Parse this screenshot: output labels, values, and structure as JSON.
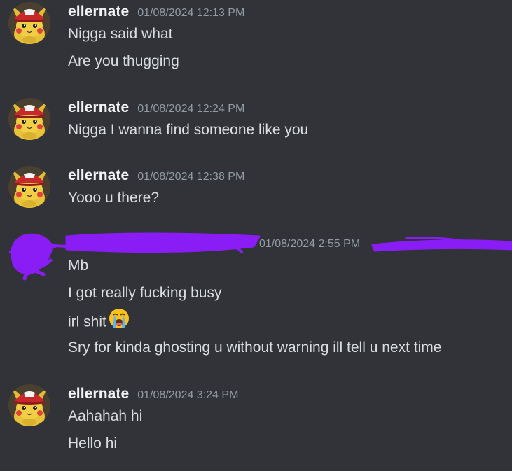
{
  "colors": {
    "background": "#313338",
    "username": "#f2f3f5",
    "timestamp": "#949ba4",
    "message_text": "#dbdee1",
    "redaction": "#8a1cf5"
  },
  "messages": [
    {
      "author": "ellernate",
      "timestamp": "01/08/2024 12:13 PM",
      "avatar_icon": "pikachu-with-red-cap-avatar",
      "lines": [
        "Nigga said what",
        "Are you thugging"
      ]
    },
    {
      "author": "ellernate",
      "timestamp": "01/08/2024 12:24 PM",
      "avatar_icon": "pikachu-with-red-cap-avatar",
      "lines": [
        "Nigga I wanna find someone like you"
      ]
    },
    {
      "author": "ellernate",
      "timestamp": "01/08/2024 12:38 PM",
      "avatar_icon": "pikachu-with-red-cap-avatar",
      "lines": [
        "Yooo u there?"
      ]
    },
    {
      "author": "",
      "author_redacted": true,
      "timestamp": "01/08/2024 2:55 PM",
      "avatar_icon": "redacted-avatar",
      "lines": [
        "Mb",
        "I got really fucking busy",
        "irl shit",
        "Sry for kinda ghosting u without warning ill tell u next time"
      ],
      "emoji": "loudly-crying-face-emoji"
    },
    {
      "author": "ellernate",
      "timestamp": "01/08/2024 3:24 PM",
      "avatar_icon": "pikachu-with-red-cap-avatar",
      "lines": [
        "Aahahah hi",
        "Hello hi"
      ]
    }
  ]
}
